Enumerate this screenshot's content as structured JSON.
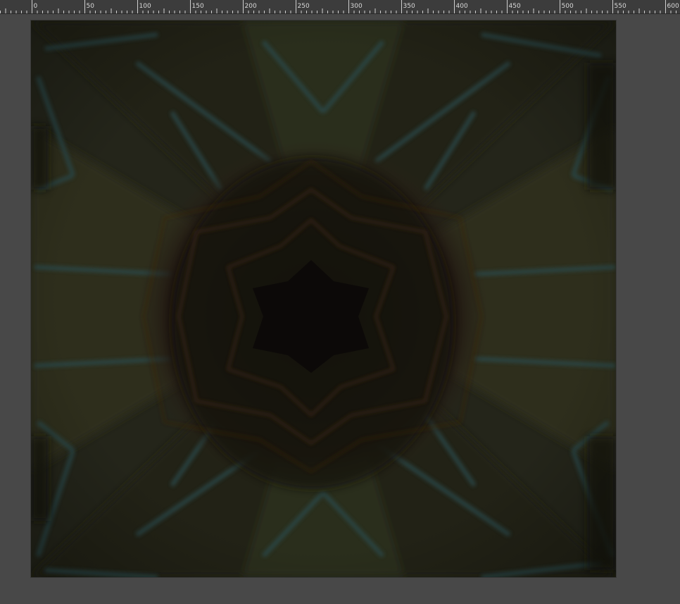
{
  "ruler": {
    "labels": [
      "0",
      "50",
      "100",
      "150",
      "200",
      "250",
      "300",
      "350",
      "400",
      "450",
      "500",
      "550",
      "600"
    ]
  },
  "image": {
    "description_icon": "kaleidoscope-image",
    "colors": {
      "background": "#1d1d12",
      "olive": "#2c2d1c",
      "olive_light": "#35362a",
      "teal": "#2c4a4a",
      "center_dark": "#140f0b",
      "center_ring": "#2a1a14",
      "rust_line": "#4a2a20"
    }
  }
}
